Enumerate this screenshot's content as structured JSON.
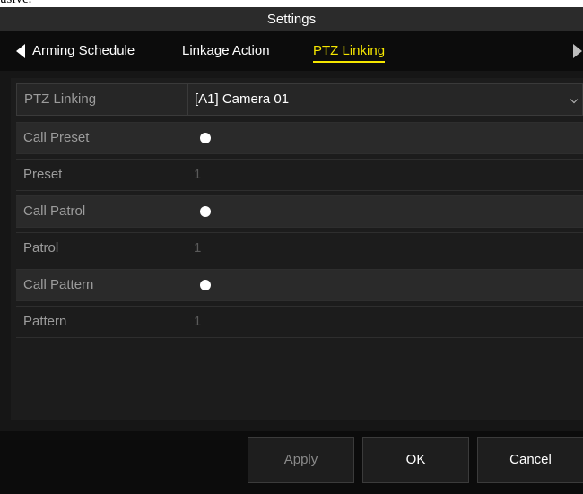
{
  "top_strip": {
    "text": "usive."
  },
  "window": {
    "title": "Settings"
  },
  "tabs": [
    {
      "label": "Arming Schedule",
      "active": false
    },
    {
      "label": "Linkage Action",
      "active": false
    },
    {
      "label": "PTZ Linking",
      "active": true
    }
  ],
  "ptz_linking": {
    "label": "PTZ Linking",
    "camera_value": "[A1] Camera 01"
  },
  "rows": [
    {
      "label": "Call Preset",
      "type": "toggle",
      "checked": true
    },
    {
      "label": "Preset",
      "type": "value",
      "value": "1"
    },
    {
      "label": "Call Patrol",
      "type": "toggle",
      "checked": true
    },
    {
      "label": "Patrol",
      "type": "value",
      "value": "1"
    },
    {
      "label": "Call Pattern",
      "type": "toggle",
      "checked": true
    },
    {
      "label": "Pattern",
      "type": "value",
      "value": "1"
    }
  ],
  "buttons": {
    "apply": "Apply",
    "ok": "OK",
    "cancel": "Cancel"
  },
  "icons": {
    "tab_left": "triangle-left-icon",
    "tab_right": "triangle-right-icon",
    "dropdown": "chevron-down-icon",
    "toggle": "radio-dot-icon"
  },
  "colors": {
    "active_tab": "#f5e600",
    "background": "#161616"
  }
}
